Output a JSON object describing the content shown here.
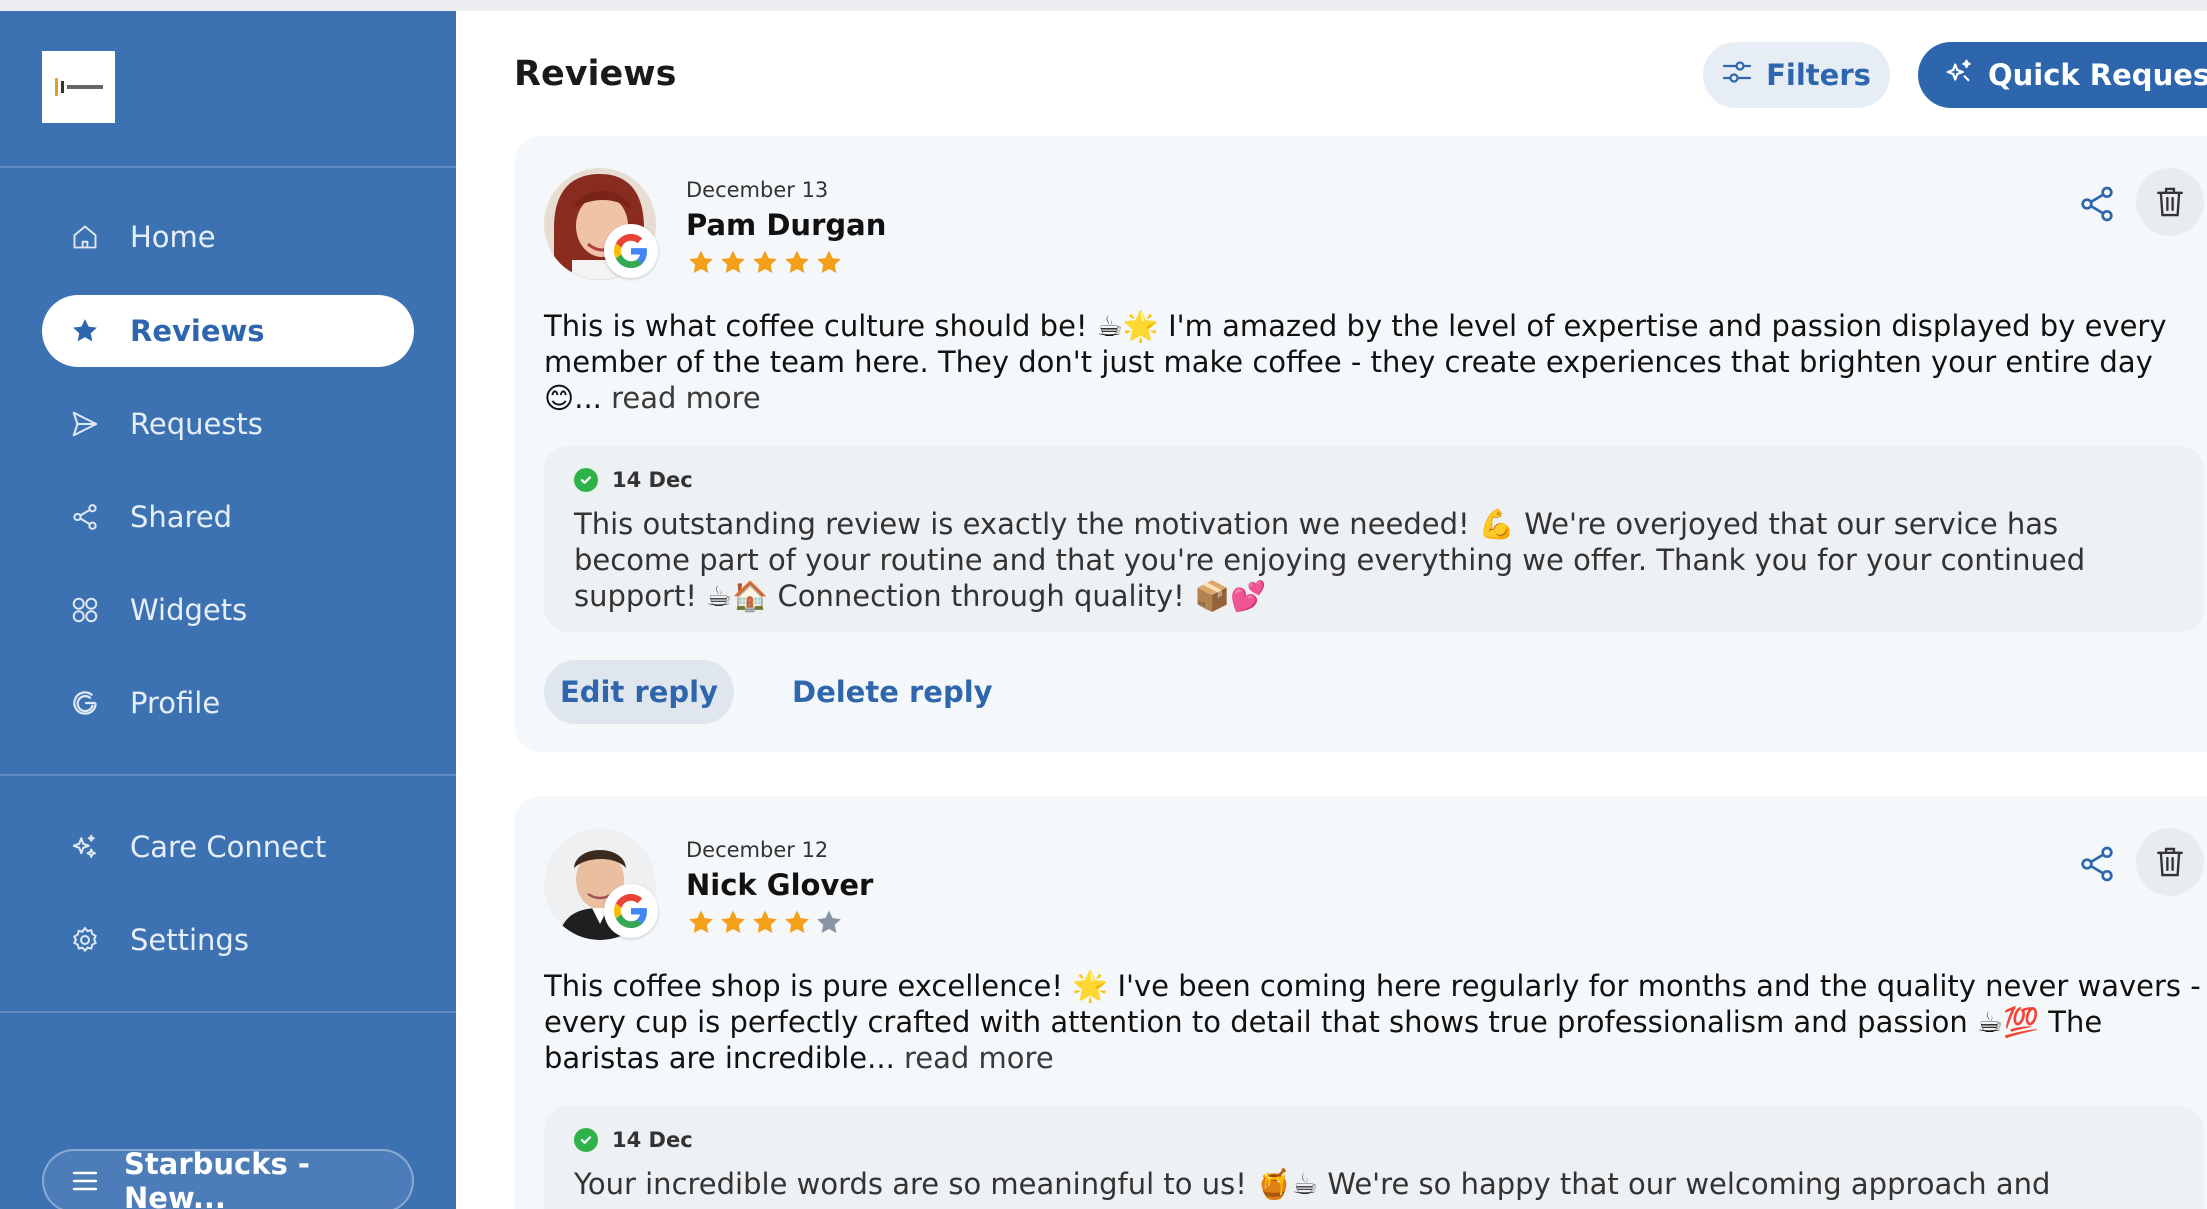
{
  "page": {
    "title": "Reviews"
  },
  "header": {
    "filters_label": "Filters",
    "quick_request_label": "Quick Request"
  },
  "sidebar": {
    "items": [
      {
        "label": "Home",
        "icon": "home-icon"
      },
      {
        "label": "Reviews",
        "icon": "star-icon",
        "active": true
      },
      {
        "label": "Requests",
        "icon": "send-icon"
      },
      {
        "label": "Shared",
        "icon": "share-icon"
      },
      {
        "label": "Widgets",
        "icon": "widgets-icon"
      },
      {
        "label": "Profile",
        "icon": "google-icon"
      },
      {
        "label": "Care Connect",
        "icon": "sparkle-icon"
      },
      {
        "label": "Settings",
        "icon": "gear-icon"
      }
    ],
    "store_label": "Starbucks - New..."
  },
  "colors": {
    "sidebar": "#3d72b2",
    "accent": "#2e66ad",
    "star": "#f5a01a",
    "star_empty": "#8a95a3",
    "check": "#2db34a"
  },
  "reviews": [
    {
      "date": "December 13",
      "name": "Pam Durgan",
      "rating": 5,
      "text": "This is what coffee culture should be! ☕🌟 I'm amazed by the level of expertise and passion displayed by every member of the team here. They don't just make coffee - they create experiences that brighten your entire day 😊...",
      "read_more": "read more",
      "reply": {
        "date": "14 Dec",
        "text": "This outstanding review is exactly the motivation we needed! 💪 We're overjoyed that our service has become part of your routine and that you're enjoying everything we offer. Thank you for your continued support! ☕🏠 Connection through quality! 📦💕"
      },
      "edit_label": "Edit reply",
      "delete_label": "Delete reply"
    },
    {
      "date": "December 12",
      "name": "Nick Glover",
      "rating": 4,
      "text": "This coffee shop is pure excellence! 🌟 I've been coming here regularly for months and the quality never wavers - every cup is perfectly crafted with attention to detail that shows true professionalism and passion ☕💯 The baristas are incredible...",
      "read_more": "read more",
      "reply": {
        "date": "14 Dec",
        "text": "Your incredible words are so meaningful to us! 🍯☕ We're so happy that our welcoming approach and"
      }
    }
  ]
}
